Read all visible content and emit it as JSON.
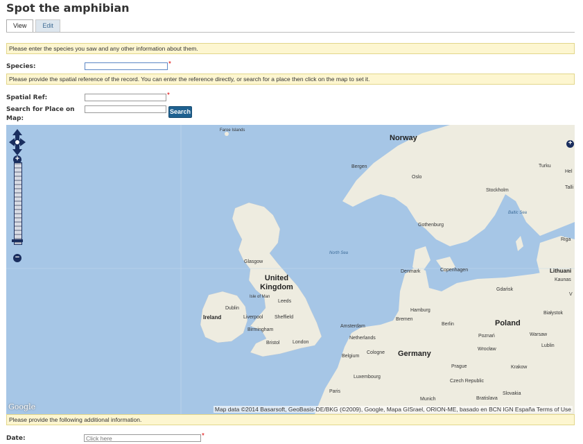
{
  "page": {
    "title": "Spot the amphibian"
  },
  "tabs": [
    {
      "label": "View",
      "active": true
    },
    {
      "label": "Edit",
      "active": false
    }
  ],
  "notices": {
    "species": "Please enter the species you saw and any other information about them.",
    "spatial": "Please provide the spatial reference of the record. You can enter the reference directly, or search for a place then click on the map to set it.",
    "additional": "Please provide the following additional information."
  },
  "fields": {
    "species": {
      "label": "Species:",
      "value": ""
    },
    "spatial_ref": {
      "label": "Spatial Ref:",
      "value": ""
    },
    "place_search": {
      "label": "Search for Place on Map:",
      "value": "",
      "button": "Search"
    },
    "date": {
      "label": "Date:",
      "placeholder": "Click here"
    }
  },
  "required_marker": "*",
  "map": {
    "labels": {
      "faroe": "Faroe Islands",
      "norway": "Norway",
      "bergen": "Bergen",
      "oslo": "Oslo",
      "stockholm": "Stockholm",
      "turku": "Turku",
      "helsinki": "Hel",
      "tallinn": "Talli",
      "baltic": "Baltic Sea",
      "gothenburg": "Gothenburg",
      "riga": "Riga",
      "north_sea": "North Sea",
      "glasgow": "Glasgow",
      "denmark": "Denmark",
      "copenhagen": "Copenhagen",
      "lithuania": "Lithuani",
      "kaunas": "Kaunas",
      "uk": "United Kingdom",
      "isle_of_man": "Isle of Man",
      "leeds": "Leeds",
      "dublin": "Dublin",
      "ireland": "Ireland",
      "liverpool": "Liverpool",
      "sheffield": "Sheffield",
      "gdansk": "Gdańsk",
      "hamburg": "Hamburg",
      "bremen": "Bremen",
      "bialystok": "Białystok",
      "birmingham": "Birmingham",
      "amsterdam": "Amsterdam",
      "berlin": "Berlin",
      "poland": "Poland",
      "poznan": "Poznań",
      "warsaw": "Warsaw",
      "netherlands": "Netherlands",
      "bristol": "Bristol",
      "london": "London",
      "wroclaw": "Wrocław",
      "lublin": "Lublin",
      "belgium": "Belgium",
      "cologne": "Cologne",
      "germany": "Germany",
      "prague": "Prague",
      "krakow": "Krakow",
      "luxembourg": "Luxembourg",
      "czech": "Czech Republic",
      "paris": "Paris",
      "munich": "Munich",
      "bratislava": "Bratislava",
      "slovakia": "Slovakia",
      "v": "V"
    },
    "logo": "Google",
    "credit": "Map data ©2014 Basarsoft, GeoBasis-DE/BKG (©2009), Google, Mapa GISrael, ORION-ME, basado en BCN IGN España   Terms of Use"
  },
  "colors": {
    "land": "#eeece0",
    "water": "#a6c6e6",
    "notice_bg": "#fdf6d0",
    "button": "#1f6190",
    "control": "#1a2e5e"
  }
}
